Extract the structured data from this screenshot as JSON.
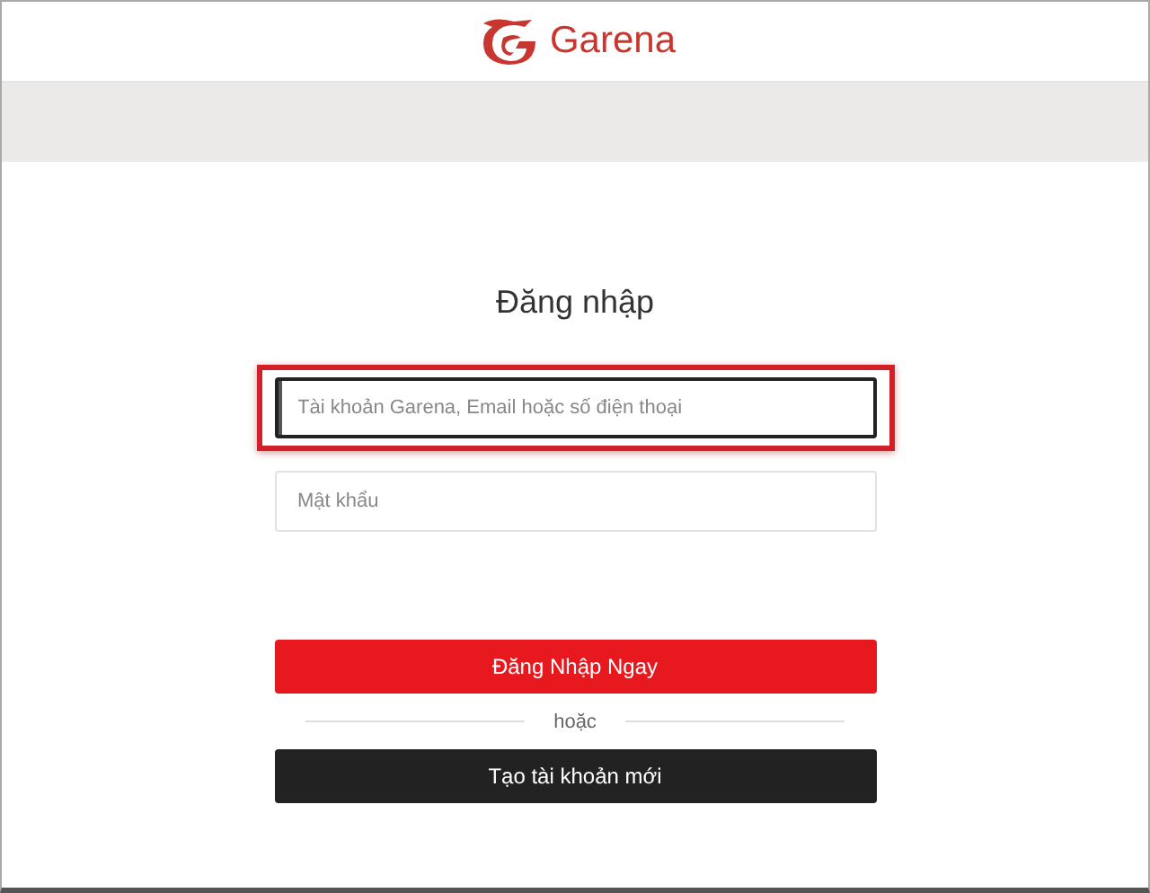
{
  "header": {
    "brand": "Garena"
  },
  "login": {
    "title": "Đăng nhập",
    "fields": [
      {
        "placeholder": "Tài khoản Garena, Email hoặc số điện thoại",
        "focused": true,
        "highlighted": true
      },
      {
        "placeholder": "Mật khẩu",
        "focused": false,
        "highlighted": false
      }
    ],
    "buttons": [
      {
        "label": "Đăng Nhập Ngay",
        "kind": "primary"
      },
      {
        "label": "Tạo tài khoản mới",
        "kind": "secondary"
      }
    ],
    "divider_text": "hoặc"
  }
}
